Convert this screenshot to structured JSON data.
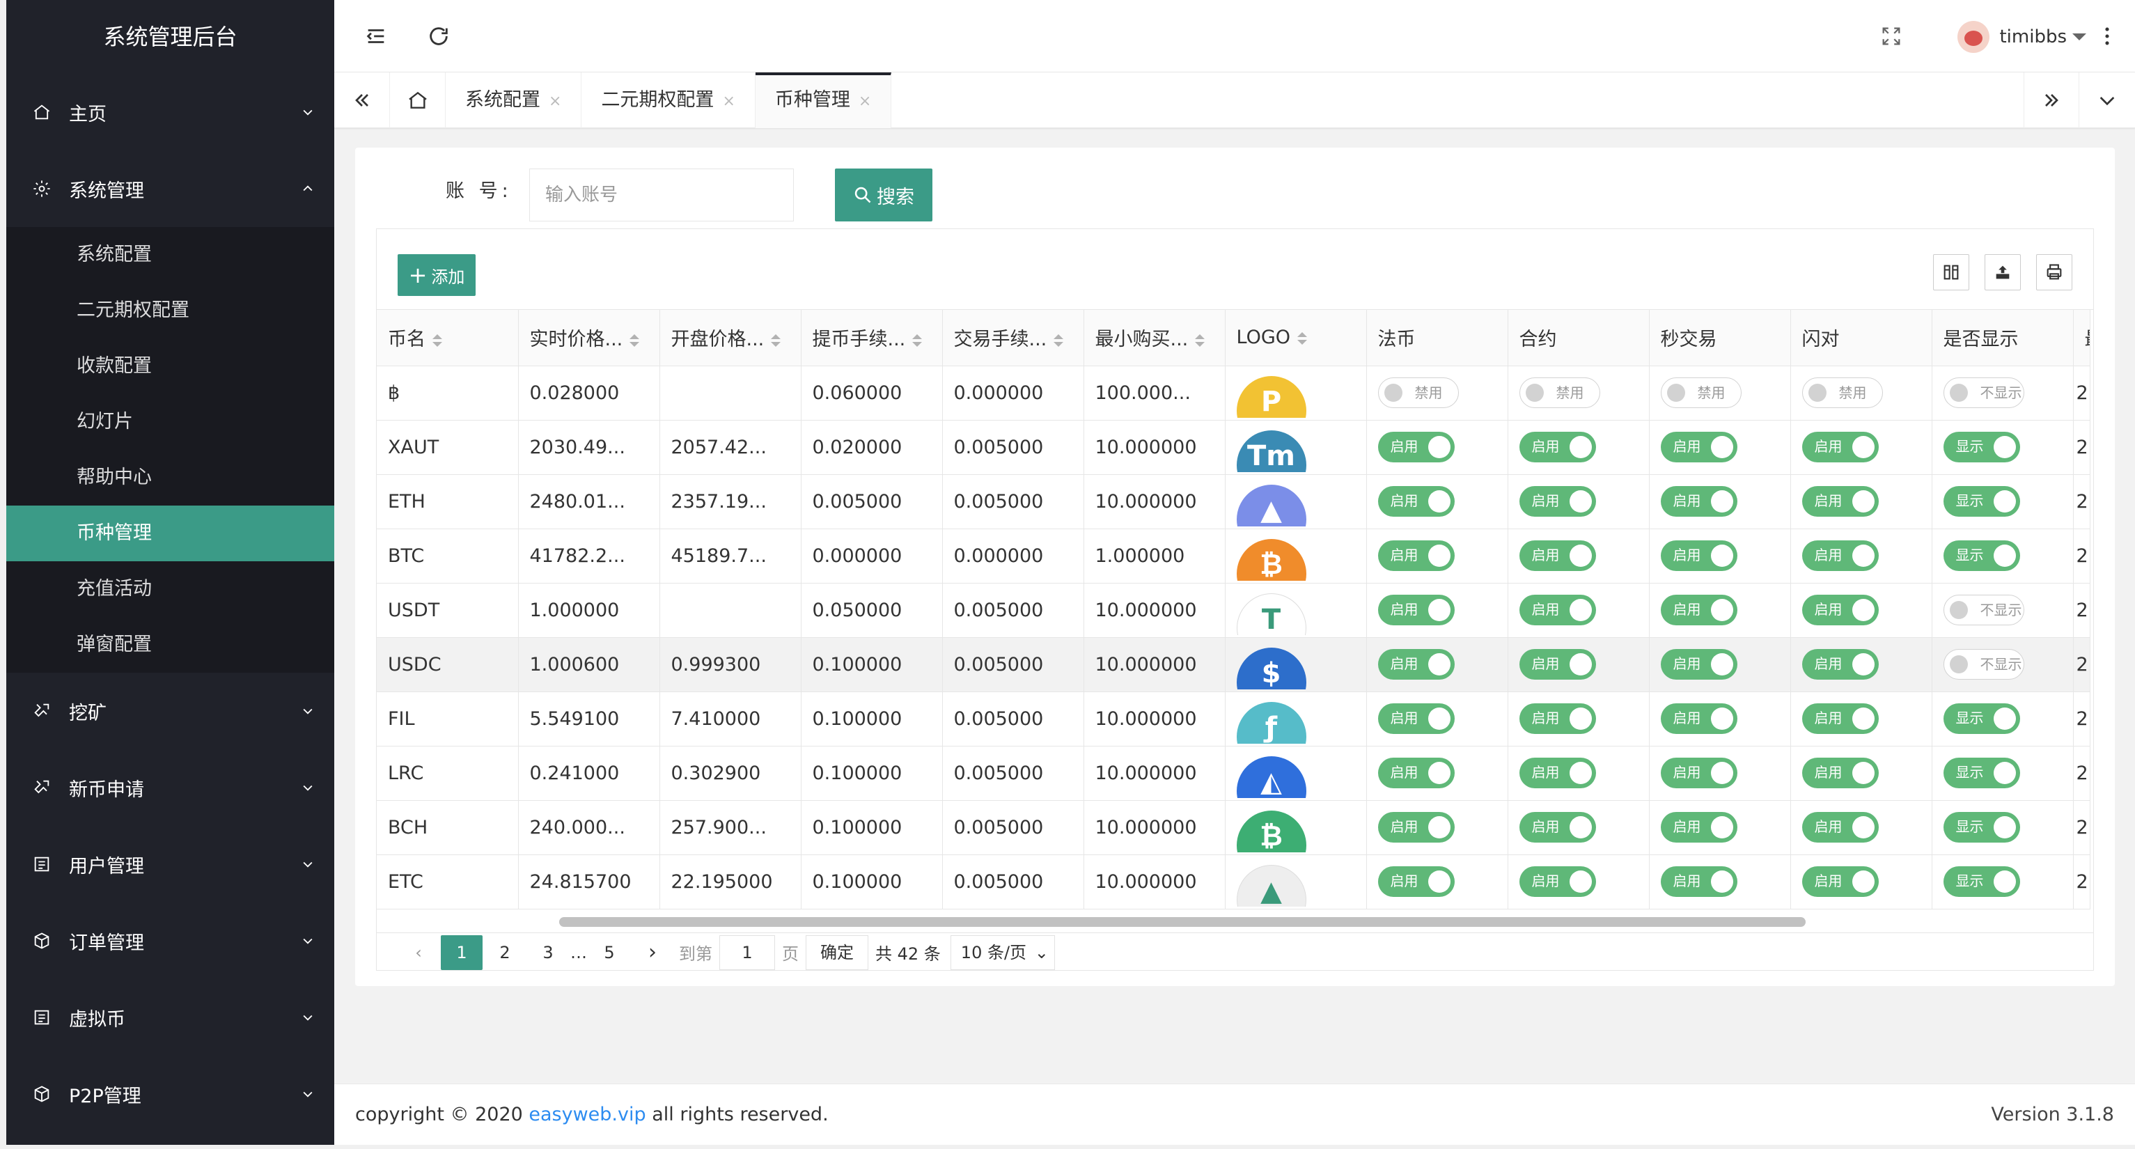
{
  "app_title": "系统管理后台",
  "sidebar": {
    "items": [
      {
        "label": "主页",
        "icon": "home-icon"
      },
      {
        "label": "系统管理",
        "icon": "gear-icon",
        "expanded": true,
        "children": [
          "系统配置",
          "二元期权配置",
          "收款配置",
          "幻灯片",
          "帮助中心",
          "币种管理",
          "充值活动",
          "弹窗配置"
        ],
        "active_child": "币种管理"
      },
      {
        "label": "挖矿",
        "icon": "settings-icon"
      },
      {
        "label": "新币申请",
        "icon": "settings-icon"
      },
      {
        "label": "用户管理",
        "icon": "list-icon"
      },
      {
        "label": "订单管理",
        "icon": "box-icon"
      },
      {
        "label": "虚拟币",
        "icon": "list-icon"
      },
      {
        "label": "P2P管理",
        "icon": "box-icon"
      }
    ]
  },
  "header": {
    "username": "timibbs"
  },
  "tabs": [
    {
      "label": "系统配置",
      "active": false
    },
    {
      "label": "二元期权配置",
      "active": false
    },
    {
      "label": "币种管理",
      "active": true
    }
  ],
  "tab_close": "×",
  "search": {
    "label": "账 号:",
    "placeholder": "输入账号",
    "button": "搜索"
  },
  "toolbar": {
    "add_label": "添加"
  },
  "table": {
    "columns": [
      "币名",
      "实时价格...",
      "开盘价格...",
      "提币手续...",
      "交易手续...",
      "最小购买...",
      "LOGO",
      "法币",
      "合约",
      "秒交易",
      "闪对",
      "是否显示",
      "最"
    ],
    "on_label": "启用",
    "off_label": "禁用",
    "show_label": "显示",
    "hide_label": "不显示",
    "rows": [
      {
        "name": "฿",
        "price": "0.028000",
        "open": "",
        "withdraw_fee": "0.060000",
        "trade_fee": "0.000000",
        "min_buy": "100.000...",
        "logo_color": "#f2c233",
        "logo_glyph": "P",
        "fiat": false,
        "contract": false,
        "second": false,
        "flash": false,
        "show": false,
        "last": "2"
      },
      {
        "name": "XAUT",
        "price": "2030.49...",
        "open": "2057.42...",
        "withdraw_fee": "0.020000",
        "trade_fee": "0.005000",
        "min_buy": "10.000000",
        "logo_color": "#3a8bb4",
        "logo_glyph": "Tm",
        "fiat": true,
        "contract": true,
        "second": true,
        "flash": true,
        "show": true,
        "last": "2"
      },
      {
        "name": "ETH",
        "price": "2480.01...",
        "open": "2357.19...",
        "withdraw_fee": "0.005000",
        "trade_fee": "0.005000",
        "min_buy": "10.000000",
        "logo_color": "#7b8ee8",
        "logo_glyph": "▲",
        "fiat": true,
        "contract": true,
        "second": true,
        "flash": true,
        "show": true,
        "last": "2"
      },
      {
        "name": "BTC",
        "price": "41782.2...",
        "open": "45189.7...",
        "withdraw_fee": "0.000000",
        "trade_fee": "0.000000",
        "min_buy": "1.000000",
        "logo_color": "#f08c2b",
        "logo_glyph": "₿",
        "fiat": true,
        "contract": true,
        "second": true,
        "flash": true,
        "show": true,
        "last": "2"
      },
      {
        "name": "USDT",
        "price": "1.000000",
        "open": "",
        "withdraw_fee": "0.050000",
        "trade_fee": "0.005000",
        "min_buy": "10.000000",
        "logo_color": "#ffffff",
        "logo_glyph": "T",
        "fiat": true,
        "contract": true,
        "second": true,
        "flash": true,
        "show": false,
        "last": "2"
      },
      {
        "name": "USDC",
        "price": "1.000600",
        "open": "0.999300",
        "withdraw_fee": "0.100000",
        "trade_fee": "0.005000",
        "min_buy": "10.000000",
        "logo_color": "#2d6ecb",
        "logo_glyph": "$",
        "fiat": true,
        "contract": true,
        "second": true,
        "flash": true,
        "show": false,
        "last": "2"
      },
      {
        "name": "FIL",
        "price": "5.549100",
        "open": "7.410000",
        "withdraw_fee": "0.100000",
        "trade_fee": "0.005000",
        "min_buy": "10.000000",
        "logo_color": "#56bcc9",
        "logo_glyph": "ƒ",
        "fiat": true,
        "contract": true,
        "second": true,
        "flash": true,
        "show": true,
        "last": "2"
      },
      {
        "name": "LRC",
        "price": "0.241000",
        "open": "0.302900",
        "withdraw_fee": "0.100000",
        "trade_fee": "0.005000",
        "min_buy": "10.000000",
        "logo_color": "#2f6fdc",
        "logo_glyph": "◭",
        "fiat": true,
        "contract": true,
        "second": true,
        "flash": true,
        "show": true,
        "last": "2"
      },
      {
        "name": "BCH",
        "price": "240.000...",
        "open": "257.900...",
        "withdraw_fee": "0.100000",
        "trade_fee": "0.005000",
        "min_buy": "10.000000",
        "logo_color": "#3dae73",
        "logo_glyph": "₿",
        "fiat": true,
        "contract": true,
        "second": true,
        "flash": true,
        "show": true,
        "last": "2"
      },
      {
        "name": "ETC",
        "price": "24.815700",
        "open": "22.195000",
        "withdraw_fee": "0.100000",
        "trade_fee": "0.005000",
        "min_buy": "10.000000",
        "logo_color": "#eeeeee",
        "logo_glyph": "▲",
        "fiat": true,
        "contract": true,
        "second": true,
        "flash": true,
        "show": true,
        "last": "2"
      }
    ]
  },
  "pagination": {
    "pages": [
      "1",
      "2",
      "3",
      "…",
      "5"
    ],
    "current": "1",
    "goto_label": "到第",
    "goto_value": "1",
    "page_unit": "页",
    "confirm": "确定",
    "total": "共 42 条",
    "page_size": "10 条/页"
  },
  "footer": {
    "copyright_prefix": "copyright © 2020 ",
    "link": "easyweb.vip",
    "copyright_suffix": " all rights reserved.",
    "version": "Version 3.1.8"
  },
  "colors": {
    "accent": "#3b9b87",
    "sidebar_bg": "#20222a",
    "switch_on": "#5fb878"
  }
}
